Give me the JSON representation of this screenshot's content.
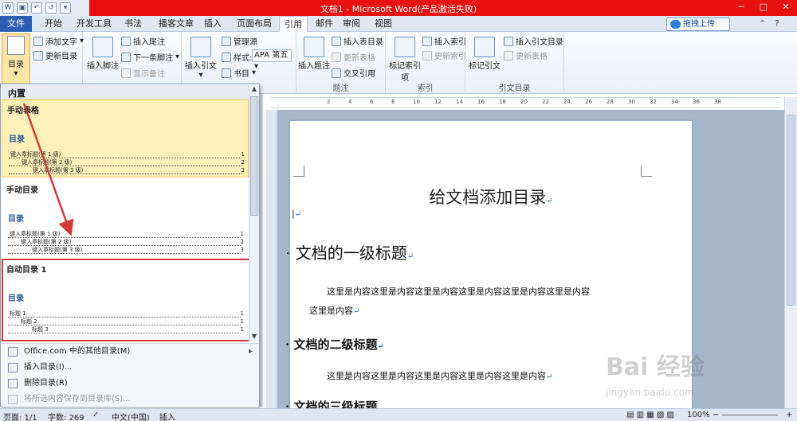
{
  "title_bar": {
    "title": "文档1 - Microsoft Word(产品激活失败)",
    "qat": [
      "W",
      "▣",
      "↶",
      "↺",
      "▾"
    ],
    "window_controls": [
      "─",
      "□",
      "✕"
    ]
  },
  "tabs": [
    "文件",
    "开始",
    "开发工具",
    "书法",
    "播客文章",
    "插入",
    "页面布局",
    "引用",
    "邮件",
    "审阅",
    "视图"
  ],
  "active_tab": "引用",
  "upload_label": "拖拽上传",
  "ribbon": {
    "toc": {
      "big_label": "目录",
      "add_text": "添加文字",
      "update_toc": "更新目录"
    },
    "footnotes": {
      "insert_footnote": "插入脚注",
      "insert_endnote": "插入尾注",
      "next_footnote": "下一条脚注",
      "show_notes": "显示备注"
    },
    "citations": {
      "insert_citation": "插入引文",
      "manage_sources": "管理源",
      "style_label": "样式:",
      "style_value": "APA 第五",
      "bibliography": "书目"
    },
    "captions": {
      "insert_caption": "插入题注",
      "insert_table_of_figures": "插入表目录",
      "update_table": "更新表格",
      "cross_reference": "交叉引用",
      "group_label": "题注"
    },
    "index": {
      "mark_entry": "标记索引项",
      "insert_index": "插入索引",
      "update_index": "更新索引",
      "group_label": "索引"
    },
    "toa": {
      "mark_citation": "标记引文",
      "insert_toa": "插入引文目录",
      "update_table": "更新表格",
      "group_label": "引文目录"
    }
  },
  "ruler_numbers": [
    "2",
    "4",
    "6",
    "8",
    "10",
    "12",
    "14",
    "16",
    "18",
    "20",
    "22",
    "24",
    "26",
    "28",
    "30",
    "32",
    "34",
    "36",
    "38"
  ],
  "document": {
    "title": "给文档添加目录",
    "h1": "文档的一级标题",
    "body1_line1": "这里是内容这里是内容这里是内容这里是内容这里是内容这里是内容",
    "body1_line2": "这里是内容",
    "h2a": "文档的二级标题",
    "body2": "这里是内容这里是内容这里是内容这里是内容这里是内容",
    "h2b": "文档的三级标题",
    "para_mark": "↵"
  },
  "toc_gallery": {
    "header": "内置",
    "items": [
      {
        "label": "手动表格",
        "preview_title": "目录",
        "lines": [
          {
            "text": "键入章标题(第 1 级)",
            "page": "1"
          },
          {
            "text": "键入章标题(第 2 级)",
            "page": "2"
          },
          {
            "text": "键入章标题(第 3 级)",
            "page": "3"
          }
        ]
      },
      {
        "label": "手动目录",
        "preview_title": "目录",
        "lines": [
          {
            "text": "键入章标题(第 1 级)",
            "page": "1"
          },
          {
            "text": "键入章标题(第 2 级)",
            "page": "2"
          },
          {
            "text": "键入章标题(第 3 级)",
            "page": "3"
          }
        ]
      },
      {
        "label": "自动目录 1",
        "preview_title": "目录",
        "lines": [
          {
            "text": "标题 1",
            "page": "1"
          },
          {
            "text": "标题 2",
            "page": "1"
          },
          {
            "text": "标题 3",
            "page": "1"
          }
        ]
      }
    ],
    "menu": [
      {
        "label": "Office.com 中的其他目录(M)",
        "arrow": "▸",
        "disabled": false
      },
      {
        "label": "插入目录(I)...",
        "disabled": false
      },
      {
        "label": "删除目录(R)",
        "disabled": false
      },
      {
        "label": "将所选内容保存到目录库(S)...",
        "disabled": true
      }
    ]
  },
  "status_bar": {
    "page": "页面: 1/1",
    "words": "字数: 269",
    "lang": "中文(中国)",
    "mode": "插入",
    "zoom": "100%",
    "zoom_minus": "−",
    "zoom_plus": "+"
  },
  "watermark": {
    "brand": "Bai 经验",
    "url": "jingyan.baidu.com"
  },
  "colors": {
    "titlebar_red": "#e81010",
    "file_tab": "#2b5fb4",
    "highlight": "#fdf0b8",
    "annotation_red": "#d23b3b"
  }
}
